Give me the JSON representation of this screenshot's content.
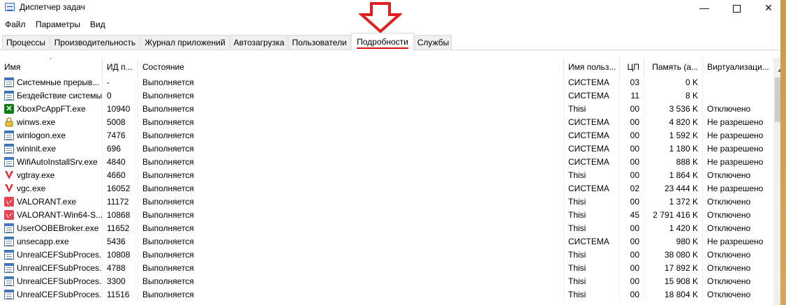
{
  "window": {
    "title": "Диспетчер задач"
  },
  "window_controls": {
    "minimize": "—",
    "close": "✕"
  },
  "menu": [
    "Файл",
    "Параметры",
    "Вид"
  ],
  "tabs": [
    "Процессы",
    "Производительность",
    "Журнал приложений",
    "Автозагрузка",
    "Пользователи",
    "Подробности",
    "Службы"
  ],
  "active_tab": "Подробности",
  "annotation": {
    "arrow_color": "#e02020"
  },
  "columns": {
    "name": "Имя",
    "pid": "ИД п...",
    "state": "Состояние",
    "user": "Имя польз...",
    "cpu": "ЦП",
    "mem": "Память (а...",
    "virt": "Виртуализаци..."
  },
  "rows": [
    {
      "icon": "window-icon",
      "name": "Системные прерыв...",
      "pid": "-",
      "state": "Выполняется",
      "user": "СИСТЕМА",
      "cpu": "03",
      "mem": "0 K",
      "virt": ""
    },
    {
      "icon": "window-icon",
      "name": "Бездействие системы",
      "pid": "0",
      "state": "Выполняется",
      "user": "СИСТЕМА",
      "cpu": "11",
      "mem": "8 K",
      "virt": ""
    },
    {
      "icon": "xbox-icon",
      "name": "XboxPcAppFT.exe",
      "pid": "10940",
      "state": "Выполняется",
      "user": "Thisi",
      "cpu": "00",
      "mem": "3 536 K",
      "virt": "Отключено"
    },
    {
      "icon": "lock-icon",
      "name": "winws.exe",
      "pid": "5008",
      "state": "Выполняется",
      "user": "СИСТЕМА",
      "cpu": "00",
      "mem": "4 820 K",
      "virt": "Не разрешено"
    },
    {
      "icon": "window-icon",
      "name": "winlogon.exe",
      "pid": "7476",
      "state": "Выполняется",
      "user": "СИСТЕМА",
      "cpu": "00",
      "mem": "1 592 K",
      "virt": "Не разрешено"
    },
    {
      "icon": "window-icon",
      "name": "wininit.exe",
      "pid": "696",
      "state": "Выполняется",
      "user": "СИСТЕМА",
      "cpu": "00",
      "mem": "1 180 K",
      "virt": "Не разрешено"
    },
    {
      "icon": "window-icon",
      "name": "WifiAutoInstallSrv.exe",
      "pid": "4840",
      "state": "Выполняется",
      "user": "СИСТЕМА",
      "cpu": "00",
      "mem": "888 K",
      "virt": "Не разрешено"
    },
    {
      "icon": "vanguard-icon",
      "name": "vgtray.exe",
      "pid": "4660",
      "state": "Выполняется",
      "user": "Thisi",
      "cpu": "00",
      "mem": "1 864 K",
      "virt": "Отключено"
    },
    {
      "icon": "vanguard-icon",
      "name": "vgc.exe",
      "pid": "16052",
      "state": "Выполняется",
      "user": "СИСТЕМА",
      "cpu": "02",
      "mem": "23 444 K",
      "virt": "Не разрешено"
    },
    {
      "icon": "valorant-icon",
      "name": "VALORANT.exe",
      "pid": "11172",
      "state": "Выполняется",
      "user": "Thisi",
      "cpu": "00",
      "mem": "1 372 K",
      "virt": "Отключено"
    },
    {
      "icon": "valorant-icon",
      "name": "VALORANT-Win64-S...",
      "pid": "10868",
      "state": "Выполняется",
      "user": "Thisi",
      "cpu": "45",
      "mem": "2 791 416 K",
      "virt": "Отключено"
    },
    {
      "icon": "window-icon",
      "name": "UserOOBEBroker.exe",
      "pid": "11652",
      "state": "Выполняется",
      "user": "Thisi",
      "cpu": "00",
      "mem": "1 420 K",
      "virt": "Отключено"
    },
    {
      "icon": "window-icon",
      "name": "unsecapp.exe",
      "pid": "5436",
      "state": "Выполняется",
      "user": "СИСТЕМА",
      "cpu": "00",
      "mem": "980 K",
      "virt": "Не разрешено"
    },
    {
      "icon": "window-icon",
      "name": "UnrealCEFSubProces...",
      "pid": "10808",
      "state": "Выполняется",
      "user": "Thisi",
      "cpu": "00",
      "mem": "38 080 K",
      "virt": "Отключено"
    },
    {
      "icon": "window-icon",
      "name": "UnrealCEFSubProces...",
      "pid": "4788",
      "state": "Выполняется",
      "user": "Thisi",
      "cpu": "00",
      "mem": "17 892 K",
      "virt": "Отключено"
    },
    {
      "icon": "window-icon",
      "name": "UnrealCEFSubProces...",
      "pid": "3300",
      "state": "Выполняется",
      "user": "Thisi",
      "cpu": "00",
      "mem": "15 908 K",
      "virt": "Отключено"
    },
    {
      "icon": "window-icon",
      "name": "UnrealCEFSubProces...",
      "pid": "11516",
      "state": "Выполняется",
      "user": "Thisi",
      "cpu": "00",
      "mem": "18 804 K",
      "virt": "Отключено"
    }
  ]
}
